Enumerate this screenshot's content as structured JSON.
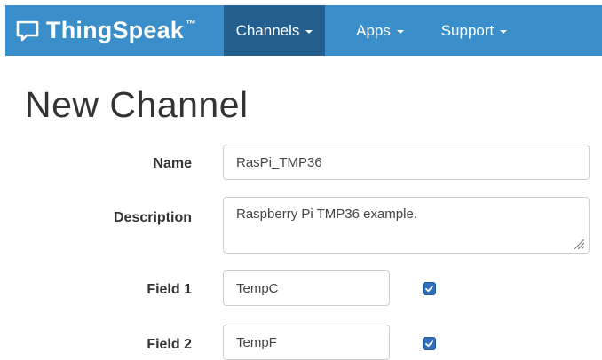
{
  "navbar": {
    "brand": "ThingSpeak",
    "brand_tm": "™",
    "items": [
      {
        "label": "Channels",
        "active": true
      },
      {
        "label": "Apps",
        "active": false
      },
      {
        "label": "Support",
        "active": false
      }
    ],
    "colors": {
      "bar": "#3a8ec9",
      "active": "#245e8f"
    }
  },
  "page": {
    "title": "New Channel"
  },
  "form": {
    "name": {
      "label": "Name",
      "value": "RasPi_TMP36"
    },
    "description": {
      "label": "Description",
      "value": "Raspberry Pi TMP36 example."
    },
    "fields": [
      {
        "label": "Field 1",
        "value": "TempC",
        "checked": true
      },
      {
        "label": "Field 2",
        "value": "TempF",
        "checked": true
      }
    ],
    "checkbox_color": "#2f6fbb"
  },
  "icons": {
    "brand": "chat-bubble-icon",
    "checkbox": "checkmark-icon",
    "dropdown": "caret-down-icon",
    "resize": "resize-grip-icon"
  }
}
